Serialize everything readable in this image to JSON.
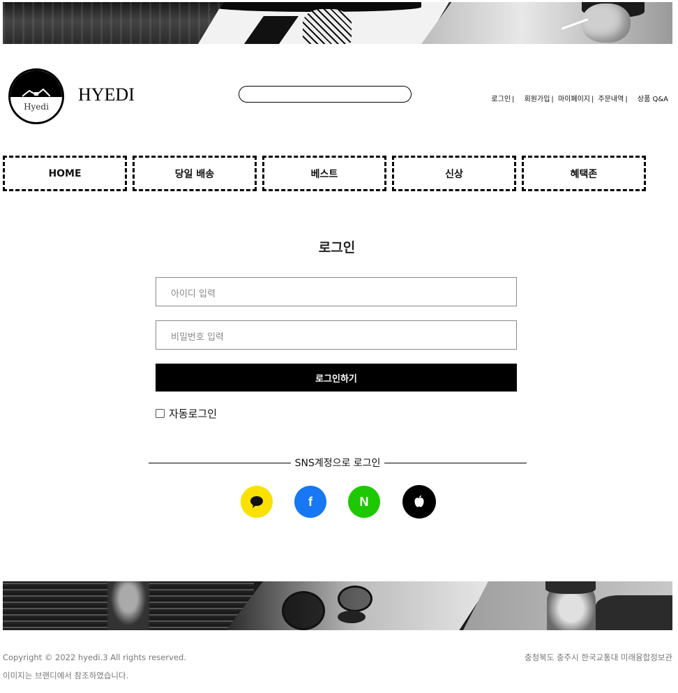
{
  "header": {
    "site_title": "HYEDI",
    "logo_text": "Hyedi",
    "search": {
      "value": "",
      "placeholder": ""
    },
    "util_links": [
      "로그인",
      "회원가입",
      "마이페이지",
      "주문내역",
      "상품 Q&A"
    ],
    "util_separator": "|"
  },
  "nav": {
    "items": [
      "HOME",
      "당일 배송",
      "베스트",
      "신상",
      "혜택존"
    ]
  },
  "login": {
    "title": "로그인",
    "id_placeholder": "아이디 입력",
    "password_placeholder": "비밀번호 입력",
    "submit_label": "로그인하기",
    "auto_login_label": "자동로그인",
    "auto_login_checked": false,
    "sns_divider_label": "SNS계정으로 로그인",
    "sns": [
      {
        "name": "kakao",
        "icon": "speech-bubble-icon",
        "color": "#FAE100",
        "glyph_color": "#111111"
      },
      {
        "name": "facebook",
        "icon": "facebook-icon",
        "color": "#1877F2",
        "glyph_color": "#ffffff",
        "glyph": "f"
      },
      {
        "name": "naver",
        "icon": "naver-icon",
        "color": "#1EC800",
        "glyph_color": "#ffffff",
        "glyph": "N"
      },
      {
        "name": "apple",
        "icon": "apple-icon",
        "color": "#000000",
        "glyph_color": "#ffffff"
      }
    ]
  },
  "footer": {
    "copyright": "Copyright © 2022 hyedi.3 All rights reserved.",
    "address": "충청북도 충주시 한국교통대 미래융합정보관",
    "notice": "이미지는 브랜디에서 참조하였습니다."
  },
  "colors": {
    "primary_button": "#000000",
    "nav_border": "#000000",
    "footer_text": "#777777"
  }
}
